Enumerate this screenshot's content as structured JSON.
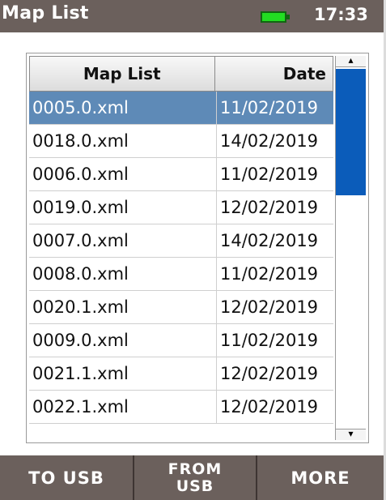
{
  "header": {
    "title": "Map List",
    "time": "17:33",
    "battery_color": "#22dd22"
  },
  "table": {
    "columns": [
      "Map List",
      "Date"
    ],
    "rows": [
      {
        "name": "0005.0.xml",
        "date": "11/02/2019",
        "selected": true
      },
      {
        "name": "0018.0.xml",
        "date": "14/02/2019"
      },
      {
        "name": "0006.0.xml",
        "date": "11/02/2019"
      },
      {
        "name": "0019.0.xml",
        "date": "12/02/2019"
      },
      {
        "name": "0007.0.xml",
        "date": "14/02/2019"
      },
      {
        "name": "0008.0.xml",
        "date": "11/02/2019"
      },
      {
        "name": "0020.1.xml",
        "date": "12/02/2019"
      },
      {
        "name": "0009.0.xml",
        "date": "11/02/2019"
      },
      {
        "name": "0021.1.xml",
        "date": "12/02/2019"
      },
      {
        "name": "0022.1.xml",
        "date": "12/02/2019"
      }
    ],
    "selection_color": "#5e8ab7",
    "scrollbar_thumb_color": "#0b5cba"
  },
  "toolbar": {
    "to_usb": "TO USB",
    "from_usb": "FROM USB",
    "more": "MORE"
  }
}
